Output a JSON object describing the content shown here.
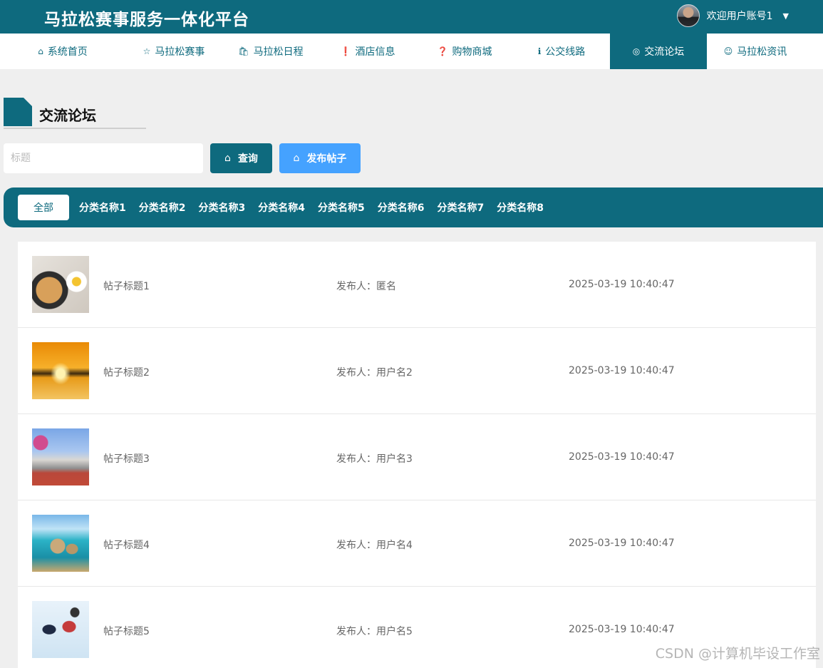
{
  "header": {
    "site_title": "马拉松赛事服务一体化平台",
    "welcome": "欢迎用户账号1",
    "caret": "▼"
  },
  "nav": {
    "items": [
      {
        "icon": "⌂",
        "label": "系统首页",
        "icon_name": "home-icon"
      },
      {
        "icon": "☆",
        "label": "马拉松赛事",
        "icon_name": "star-icon"
      },
      {
        "icon": "🛍",
        "label": "马拉松日程",
        "icon_name": "bag-icon"
      },
      {
        "icon": "❗",
        "label": "酒店信息",
        "icon_name": "alert-circle-icon"
      },
      {
        "icon": "❓",
        "label": "购物商城",
        "icon_name": "question-circle-icon"
      },
      {
        "icon": "ℹ",
        "label": "公交线路",
        "icon_name": "info-circle-icon"
      },
      {
        "icon": "◎",
        "label": "交流论坛",
        "icon_name": "target-icon"
      },
      {
        "icon": "☺",
        "label": "马拉松资讯",
        "icon_name": "smile-icon"
      }
    ],
    "active_index": 6
  },
  "section": {
    "title": "交流论坛"
  },
  "search": {
    "placeholder": "标题",
    "query_label": "查询",
    "post_label": "发布帖子"
  },
  "categories": {
    "all_label": "全部",
    "items": [
      "分类名称1",
      "分类名称2",
      "分类名称3",
      "分类名称4",
      "分类名称5",
      "分类名称6",
      "分类名称7",
      "分类名称8"
    ]
  },
  "posts": [
    {
      "title": "帖子标题1",
      "author": "发布人：匿名",
      "time": "2025-03-19 10:40:47"
    },
    {
      "title": "帖子标题2",
      "author": "发布人：用户名2",
      "time": "2025-03-19 10:40:47"
    },
    {
      "title": "帖子标题3",
      "author": "发布人：用户名3",
      "time": "2025-03-19 10:40:47"
    },
    {
      "title": "帖子标题4",
      "author": "发布人：用户名4",
      "time": "2025-03-19 10:40:47"
    },
    {
      "title": "帖子标题5",
      "author": "发布人：用户名5",
      "time": "2025-03-19 10:40:47"
    }
  ],
  "watermark": "CSDN @计算机毕设工作室",
  "colors": {
    "primary": "#0e6a7e",
    "accent": "#45a2ff",
    "background": "#efefef"
  }
}
